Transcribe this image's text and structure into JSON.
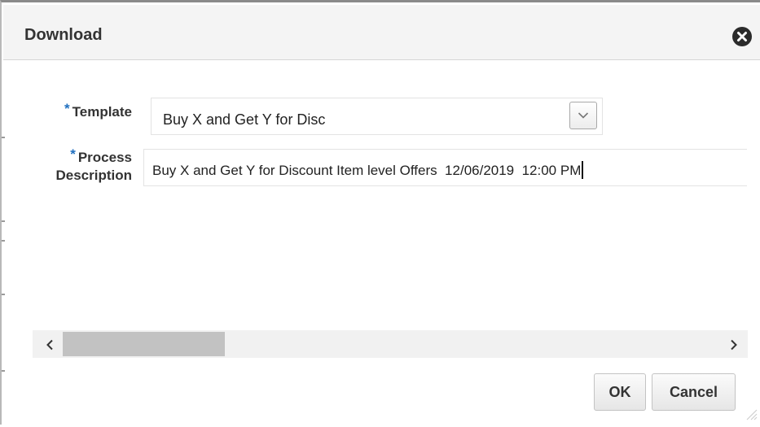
{
  "dialog": {
    "title": "Download"
  },
  "form": {
    "template": {
      "required_marker": "*",
      "label": "Template",
      "selected_value": "Buy X and Get Y for Disc"
    },
    "process_description": {
      "required_marker": "*",
      "label_line1": "Process",
      "label_line2": "Description",
      "value": "Buy X and Get Y for Discount Item level Offers  12/06/2019  12:00 PM"
    }
  },
  "scrollbar": {
    "position_fraction": 0.0
  },
  "buttons": {
    "ok_label": "OK",
    "cancel_label": "Cancel"
  },
  "icons": {
    "close": "close-circle-icon",
    "dropdown": "chevron-down-icon",
    "scroll_left": "chevron-left-icon",
    "scroll_right": "chevron-right-icon",
    "resize": "resize-grip-icon"
  },
  "colors": {
    "required_marker": "#1f6fbf",
    "header_background": "#f4f4f4",
    "close_icon": "#2b2b2b"
  }
}
